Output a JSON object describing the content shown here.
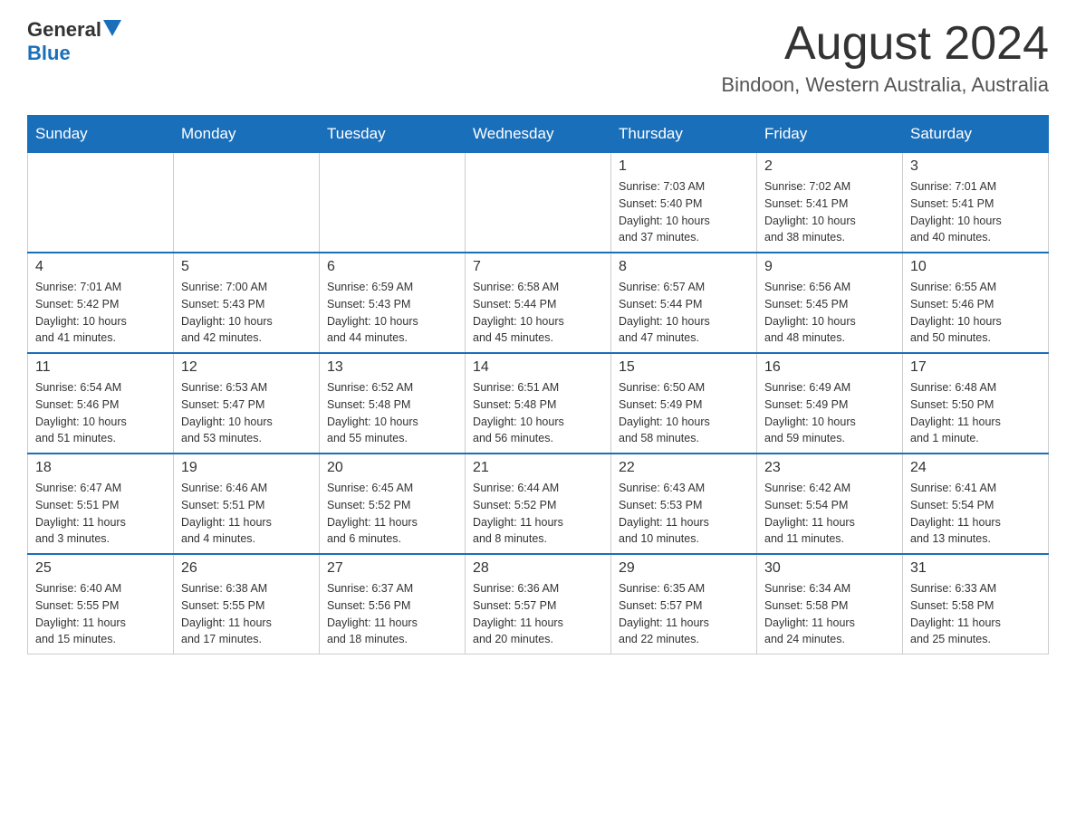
{
  "logo": {
    "general": "General",
    "blue": "Blue"
  },
  "header": {
    "month_year": "August 2024",
    "location": "Bindoon, Western Australia, Australia"
  },
  "days_of_week": [
    "Sunday",
    "Monday",
    "Tuesday",
    "Wednesday",
    "Thursday",
    "Friday",
    "Saturday"
  ],
  "weeks": [
    [
      {
        "day": "",
        "info": ""
      },
      {
        "day": "",
        "info": ""
      },
      {
        "day": "",
        "info": ""
      },
      {
        "day": "",
        "info": ""
      },
      {
        "day": "1",
        "info": "Sunrise: 7:03 AM\nSunset: 5:40 PM\nDaylight: 10 hours\nand 37 minutes."
      },
      {
        "day": "2",
        "info": "Sunrise: 7:02 AM\nSunset: 5:41 PM\nDaylight: 10 hours\nand 38 minutes."
      },
      {
        "day": "3",
        "info": "Sunrise: 7:01 AM\nSunset: 5:41 PM\nDaylight: 10 hours\nand 40 minutes."
      }
    ],
    [
      {
        "day": "4",
        "info": "Sunrise: 7:01 AM\nSunset: 5:42 PM\nDaylight: 10 hours\nand 41 minutes."
      },
      {
        "day": "5",
        "info": "Sunrise: 7:00 AM\nSunset: 5:43 PM\nDaylight: 10 hours\nand 42 minutes."
      },
      {
        "day": "6",
        "info": "Sunrise: 6:59 AM\nSunset: 5:43 PM\nDaylight: 10 hours\nand 44 minutes."
      },
      {
        "day": "7",
        "info": "Sunrise: 6:58 AM\nSunset: 5:44 PM\nDaylight: 10 hours\nand 45 minutes."
      },
      {
        "day": "8",
        "info": "Sunrise: 6:57 AM\nSunset: 5:44 PM\nDaylight: 10 hours\nand 47 minutes."
      },
      {
        "day": "9",
        "info": "Sunrise: 6:56 AM\nSunset: 5:45 PM\nDaylight: 10 hours\nand 48 minutes."
      },
      {
        "day": "10",
        "info": "Sunrise: 6:55 AM\nSunset: 5:46 PM\nDaylight: 10 hours\nand 50 minutes."
      }
    ],
    [
      {
        "day": "11",
        "info": "Sunrise: 6:54 AM\nSunset: 5:46 PM\nDaylight: 10 hours\nand 51 minutes."
      },
      {
        "day": "12",
        "info": "Sunrise: 6:53 AM\nSunset: 5:47 PM\nDaylight: 10 hours\nand 53 minutes."
      },
      {
        "day": "13",
        "info": "Sunrise: 6:52 AM\nSunset: 5:48 PM\nDaylight: 10 hours\nand 55 minutes."
      },
      {
        "day": "14",
        "info": "Sunrise: 6:51 AM\nSunset: 5:48 PM\nDaylight: 10 hours\nand 56 minutes."
      },
      {
        "day": "15",
        "info": "Sunrise: 6:50 AM\nSunset: 5:49 PM\nDaylight: 10 hours\nand 58 minutes."
      },
      {
        "day": "16",
        "info": "Sunrise: 6:49 AM\nSunset: 5:49 PM\nDaylight: 10 hours\nand 59 minutes."
      },
      {
        "day": "17",
        "info": "Sunrise: 6:48 AM\nSunset: 5:50 PM\nDaylight: 11 hours\nand 1 minute."
      }
    ],
    [
      {
        "day": "18",
        "info": "Sunrise: 6:47 AM\nSunset: 5:51 PM\nDaylight: 11 hours\nand 3 minutes."
      },
      {
        "day": "19",
        "info": "Sunrise: 6:46 AM\nSunset: 5:51 PM\nDaylight: 11 hours\nand 4 minutes."
      },
      {
        "day": "20",
        "info": "Sunrise: 6:45 AM\nSunset: 5:52 PM\nDaylight: 11 hours\nand 6 minutes."
      },
      {
        "day": "21",
        "info": "Sunrise: 6:44 AM\nSunset: 5:52 PM\nDaylight: 11 hours\nand 8 minutes."
      },
      {
        "day": "22",
        "info": "Sunrise: 6:43 AM\nSunset: 5:53 PM\nDaylight: 11 hours\nand 10 minutes."
      },
      {
        "day": "23",
        "info": "Sunrise: 6:42 AM\nSunset: 5:54 PM\nDaylight: 11 hours\nand 11 minutes."
      },
      {
        "day": "24",
        "info": "Sunrise: 6:41 AM\nSunset: 5:54 PM\nDaylight: 11 hours\nand 13 minutes."
      }
    ],
    [
      {
        "day": "25",
        "info": "Sunrise: 6:40 AM\nSunset: 5:55 PM\nDaylight: 11 hours\nand 15 minutes."
      },
      {
        "day": "26",
        "info": "Sunrise: 6:38 AM\nSunset: 5:55 PM\nDaylight: 11 hours\nand 17 minutes."
      },
      {
        "day": "27",
        "info": "Sunrise: 6:37 AM\nSunset: 5:56 PM\nDaylight: 11 hours\nand 18 minutes."
      },
      {
        "day": "28",
        "info": "Sunrise: 6:36 AM\nSunset: 5:57 PM\nDaylight: 11 hours\nand 20 minutes."
      },
      {
        "day": "29",
        "info": "Sunrise: 6:35 AM\nSunset: 5:57 PM\nDaylight: 11 hours\nand 22 minutes."
      },
      {
        "day": "30",
        "info": "Sunrise: 6:34 AM\nSunset: 5:58 PM\nDaylight: 11 hours\nand 24 minutes."
      },
      {
        "day": "31",
        "info": "Sunrise: 6:33 AM\nSunset: 5:58 PM\nDaylight: 11 hours\nand 25 minutes."
      }
    ]
  ]
}
